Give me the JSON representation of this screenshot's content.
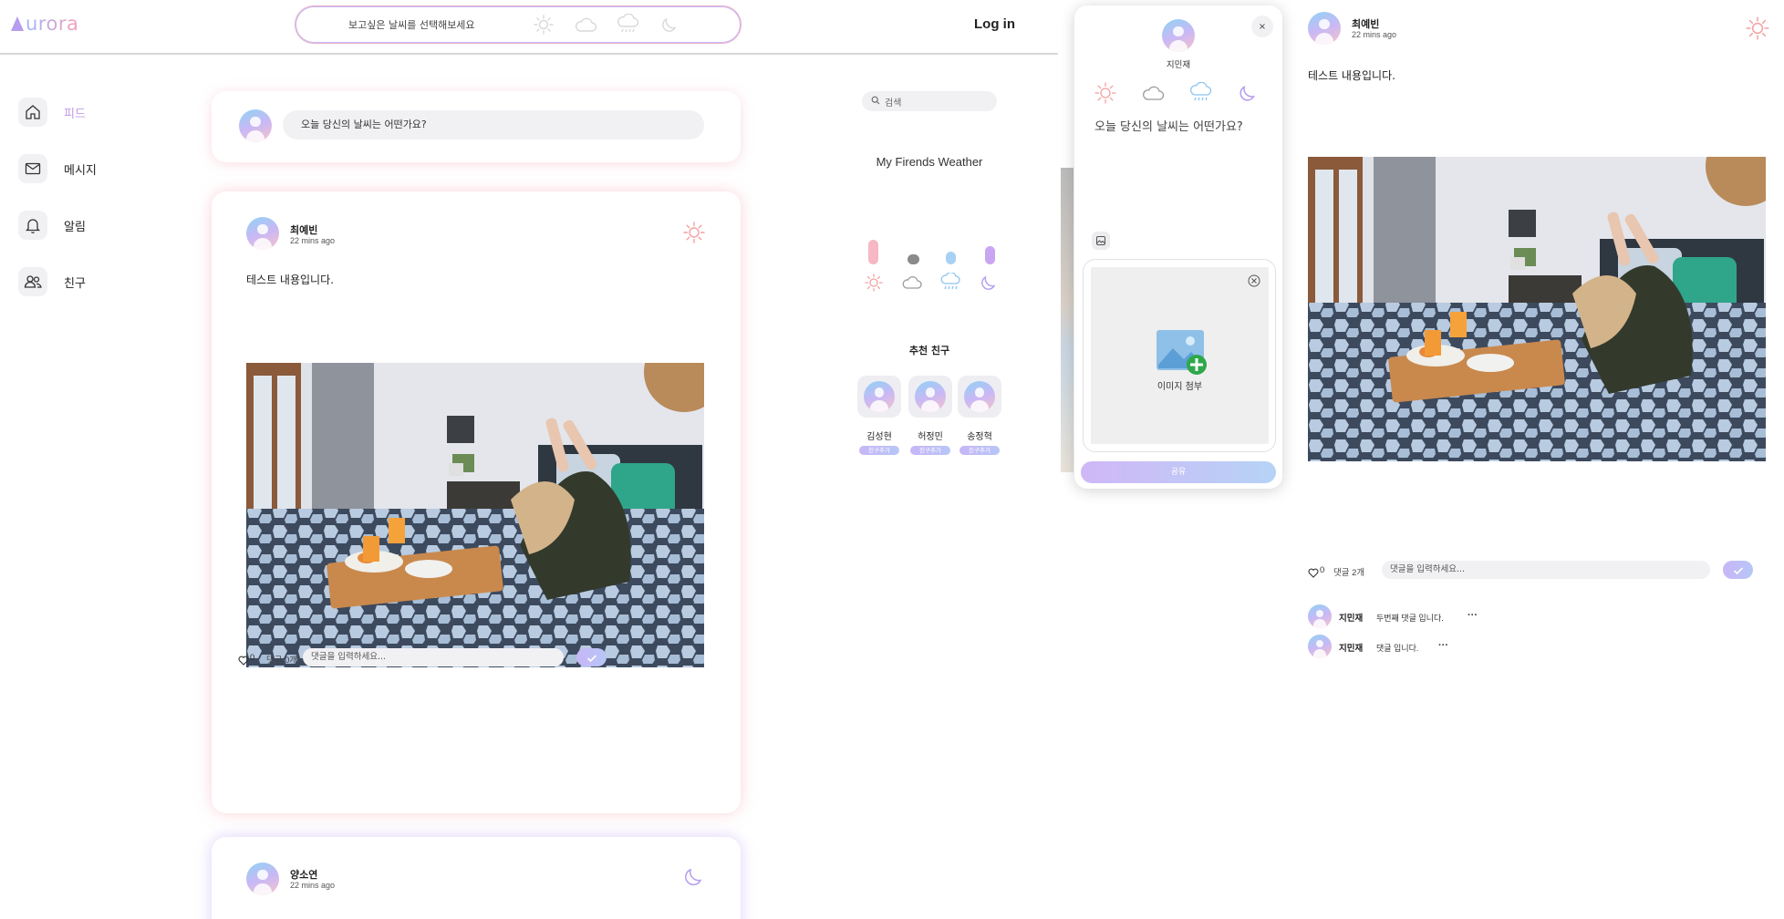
{
  "header": {
    "logo_text": "urora",
    "weather_prompt": "보고싶은 날씨를 선택해보세요",
    "weather_options": [
      "sun-icon",
      "cloud-icon",
      "rain-icon",
      "moon-icon"
    ],
    "login_label": "Log in"
  },
  "sidebar": {
    "items": [
      {
        "label": "피드",
        "icon": "home-icon",
        "active": true
      },
      {
        "label": "메시지",
        "icon": "mail-icon",
        "active": false
      },
      {
        "label": "알림",
        "icon": "bell-icon",
        "active": false
      },
      {
        "label": "친구",
        "icon": "friends-icon",
        "active": false
      }
    ]
  },
  "composer": {
    "placeholder": "오늘 당신의 날씨는 어떤가요?"
  },
  "feed": {
    "posts": [
      {
        "author": "최예빈",
        "time": "22 mins ago",
        "weather_icon": "sun-icon",
        "body": "테스트 내용입니다.",
        "likes": "0",
        "comments_label": "댓글 0개",
        "comment_placeholder": "댓글을 입력하세요..."
      },
      {
        "author": "양소연",
        "time": "22 mins ago",
        "weather_icon": "moon-icon"
      }
    ]
  },
  "right_rail": {
    "search_placeholder": "검색",
    "friends_weather_title": "My Firends Weather",
    "weather_stats": [
      {
        "icon": "sun-icon",
        "color": "#f6b8c4",
        "level": 0.9
      },
      {
        "icon": "cloud-icon",
        "color": "#8a8a8a",
        "level": 0.35
      },
      {
        "icon": "rain-icon",
        "color": "#a8d2f5",
        "level": 0.45
      },
      {
        "icon": "moon-icon",
        "color": "#c9a6f2",
        "level": 0.65
      }
    ],
    "recommend_title": "추천 친구",
    "recommended": [
      {
        "name": "김성현",
        "action": "친구추가"
      },
      {
        "name": "허정민",
        "action": "친구추가"
      },
      {
        "name": "송정혁",
        "action": "친구추가"
      }
    ]
  },
  "modal": {
    "close_label": "×",
    "user_name": "지민재",
    "weather_options": [
      "sun-icon",
      "cloud-icon",
      "rain-icon",
      "moon-icon"
    ],
    "prompt": "오늘 당신의 날씨는 어떤가요?",
    "attach_label": "이미지 첨부",
    "share_label": "공유"
  },
  "detail": {
    "author": "최예빈",
    "time": "22 mins ago",
    "weather_icon": "sun-icon",
    "body": "테스트 내용입니다.",
    "likes": "0",
    "comments_label": "댓글 2개",
    "comment_placeholder": "댓글을 입력하세요...",
    "comments": [
      {
        "author": "지민재",
        "text": "두번째 댓글 입니다."
      },
      {
        "author": "지민재",
        "text": "댓글 입니다."
      }
    ],
    "more_label": "···"
  },
  "colors": {
    "accent_pink": "#f6a8b8",
    "accent_purple": "#c7b6f7",
    "accent_blue": "#a8d2f5",
    "sun": "#f4a0a0",
    "cloud": "#9a9a9a",
    "rain": "#8cc4f0",
    "moon": "#b69cf0"
  }
}
